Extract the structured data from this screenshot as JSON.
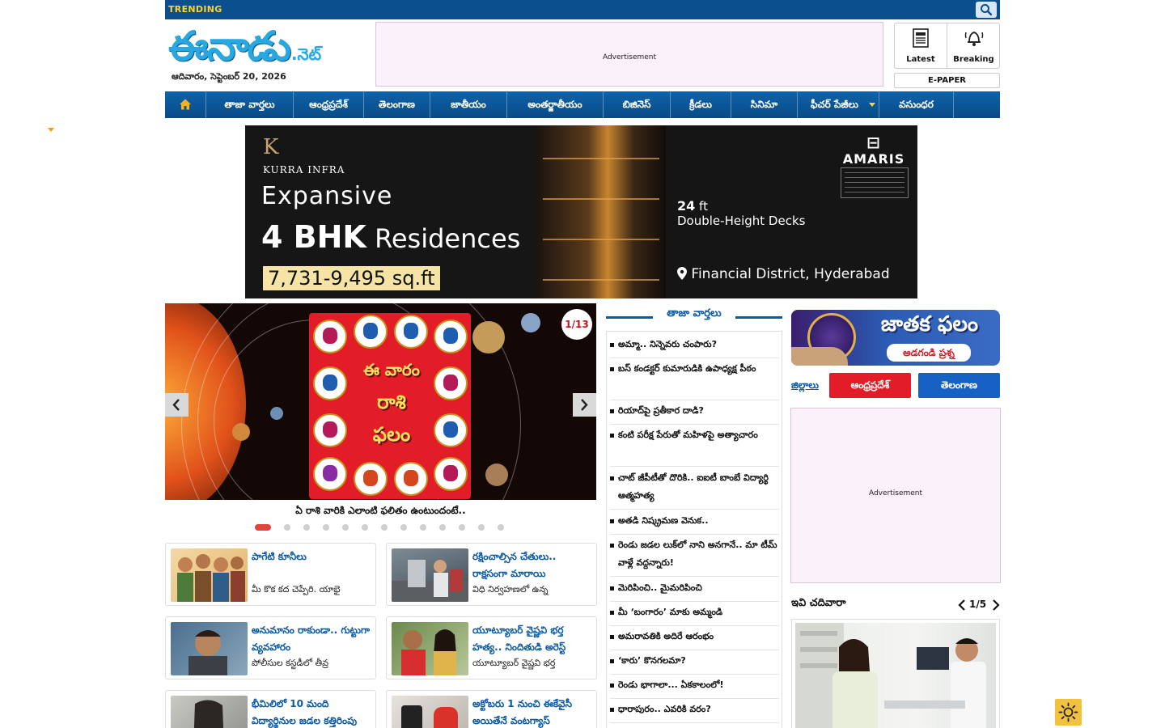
{
  "trending": {
    "label": "TRENDING"
  },
  "header": {
    "logo_text": "ఈనాడు",
    "logo_suffix": ".నెట్",
    "date": "ఆదివారం, సెప్టెంబర్ 20, 2026",
    "ad_label": "Advertisement",
    "quick_links": [
      {
        "label": "Latest",
        "icon": "news-icon"
      },
      {
        "label": "Breaking",
        "icon": "alarm-bell-icon"
      }
    ],
    "epaper": "E-PAPER"
  },
  "nav": {
    "items": [
      {
        "label": "తాజా వార్తలు"
      },
      {
        "label": "ఆంధ్రప్రదేశ్"
      },
      {
        "label": "తెలంగాణ"
      },
      {
        "label": "జాతీయం"
      },
      {
        "label": "అంతర్జాతీయం"
      },
      {
        "label": "బిజినెస్"
      },
      {
        "label": "క్రీడలు"
      },
      {
        "label": "సినిమా"
      },
      {
        "label": "ఫీచర్ పేజీలు"
      },
      {
        "label": "వసుంధర"
      }
    ]
  },
  "banner": {
    "brand": "KURRA INFRA",
    "brand_mark": "K",
    "headline1": "Expansive",
    "headline2_bold": "4 BHK",
    "headline2_rest": "Residences",
    "size": "7,731-9,495 sq.ft",
    "partner": "AMARIS",
    "feature_bold": "24",
    "feature_unit": "ft",
    "feature_rest": "Double-Height Decks",
    "location": "Financial District, Hyderabad"
  },
  "slider": {
    "counter": "1/13",
    "title_line1": "ఈ వారం",
    "title_line2": "రాశి",
    "title_line3": "ఫలం",
    "caption": "ఏ రాశి వారికి ఎలాంటి ఫలితం ఉంటుందంటే..",
    "slide_count": 13,
    "active_index": 0
  },
  "cards": [
    {
      "title": "పాగేటి కూనీలు",
      "summary": "మీ కొక కద చెప్పేరి. యాభై"
    },
    {
      "title": "రక్షించాల్సిన చేతులు.. రాక్షసంగా మారాయి",
      "summary": "విధి నిర్వహణలో ఉన్న"
    },
    {
      "title": "అనుమానం రాకుండా.. గుట్టుగా వ్యవహారం",
      "summary": "పోలీసుల కస్టడీలో తీవ్ర"
    },
    {
      "title": "యూట్యూబర్ వైష్ణవి భర్త హత్య.. నిందితుడి అరెస్ట్",
      "summary": "యూట్యూబర్ వైష్ణవి భర్త"
    },
    {
      "title": "భీమిలిలో 10 మంది విద్యార్థినుల జడల కత్తిరింపు",
      "summary": ""
    },
    {
      "title": "అక్టోబరు 1 నుంచి ఈకేవైసీ అయితేనే వంటగ్యాస్",
      "summary": ""
    }
  ],
  "latest": {
    "heading": "తాజా వార్తలు",
    "items": [
      "అమ్మా.. నిన్నెవరు చంపారు?",
      "బస్ కండక్టర్ కుమారుడికి ఉపాధ్యక్ష పీఠం",
      "రియాద్‌పై ప్రతీకార దాడి?",
      "కంటి పరీక్ష పేరుతో మహిళపై అత్యాచారం",
      "చాట్ జీపీటీతో దొరికి.. ఐఐటీ బాంబే విద్యార్థి ఆత్మహత్య",
      "అతడి నిష్క్రమణ వెనుక..",
      "రెండు జడల లుక్‌లో నాని అనగానే.. మా టీమ్ వాళ్లే వద్దన్నారు!",
      "మెరిపించి.. మైమరిపించి",
      "మీ ‘బంగారం’ మాకు అమ్మండి",
      "అమరావతికి అదిరే ఆరంభం",
      "‘కారు’ కొనగలమా?",
      "రెండు భాగాలా... ఏకకాలంలో!",
      "ధారాపురం.. ఎవరికి వరం?"
    ]
  },
  "right": {
    "horoscope_title": "జాతక ఫలం",
    "horoscope_sub": "అడగండి ప్రశ్న",
    "districts_label": "జిల్లాలు",
    "districts": [
      {
        "label": "ఆంధ్రప్రదేశ్",
        "color": "#e21d27"
      },
      {
        "label": "తెలంగాణ",
        "color": "#1761c4"
      }
    ],
    "ad_label": "Advertisement",
    "read_heading": "ఇవి చదివారా",
    "read_pager": "1/5"
  },
  "colors": {
    "brand_blue": "#0b4f8e",
    "accent_yellow": "#ffd42a",
    "link_blue": "#0b5aa3"
  }
}
